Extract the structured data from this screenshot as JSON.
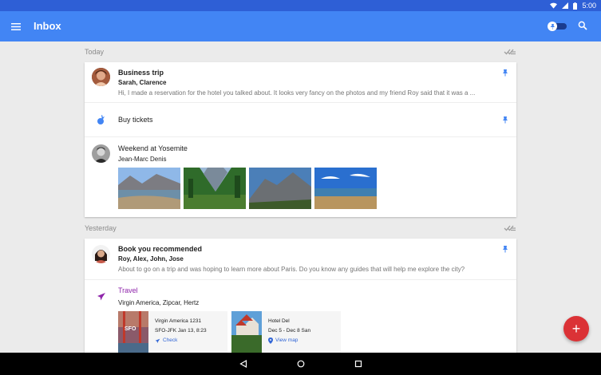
{
  "status_bar": {
    "time": "5:00"
  },
  "app_bar": {
    "title": "Inbox"
  },
  "sections": {
    "today": {
      "label": "Today"
    },
    "yesterday": {
      "label": "Yesterday"
    }
  },
  "today_items": [
    {
      "subject": "Business trip",
      "from": "Sarah, Clarence",
      "snippet": "Hi, I made a reservation for the hotel you talked about. It looks very fancy on the photos and my friend Roy said that it was a ..."
    },
    {
      "subject": "Buy tickets"
    },
    {
      "subject": "Weekend at Yosemite",
      "from": "Jean-Marc Denis"
    }
  ],
  "yesterday_items": [
    {
      "subject": "Book you recommended",
      "from": "Roy, Alex, John, Jose",
      "snippet": "About to go on a trip and was hoping to learn more about Paris. Do you know any guides that will help me explore the city?"
    },
    {
      "bundle": "Travel",
      "from": "Virgin America, Zipcar, Hertz",
      "cards": [
        {
          "title": "Virgin America 1231",
          "detail": "SFO-JFK Jan 13, 8:23",
          "action": "Check",
          "thumb_label": "SFO"
        },
        {
          "title": "Hotel Del",
          "detail": "Dec 5 - Dec 8  San",
          "action": "View map"
        }
      ]
    }
  ],
  "colors": {
    "primary": "#4285f4",
    "status_bar": "#2e5fd6",
    "fab": "#db3236",
    "travel": "#8e24aa",
    "link": "#3367d6"
  },
  "fab": {
    "label": "+"
  }
}
